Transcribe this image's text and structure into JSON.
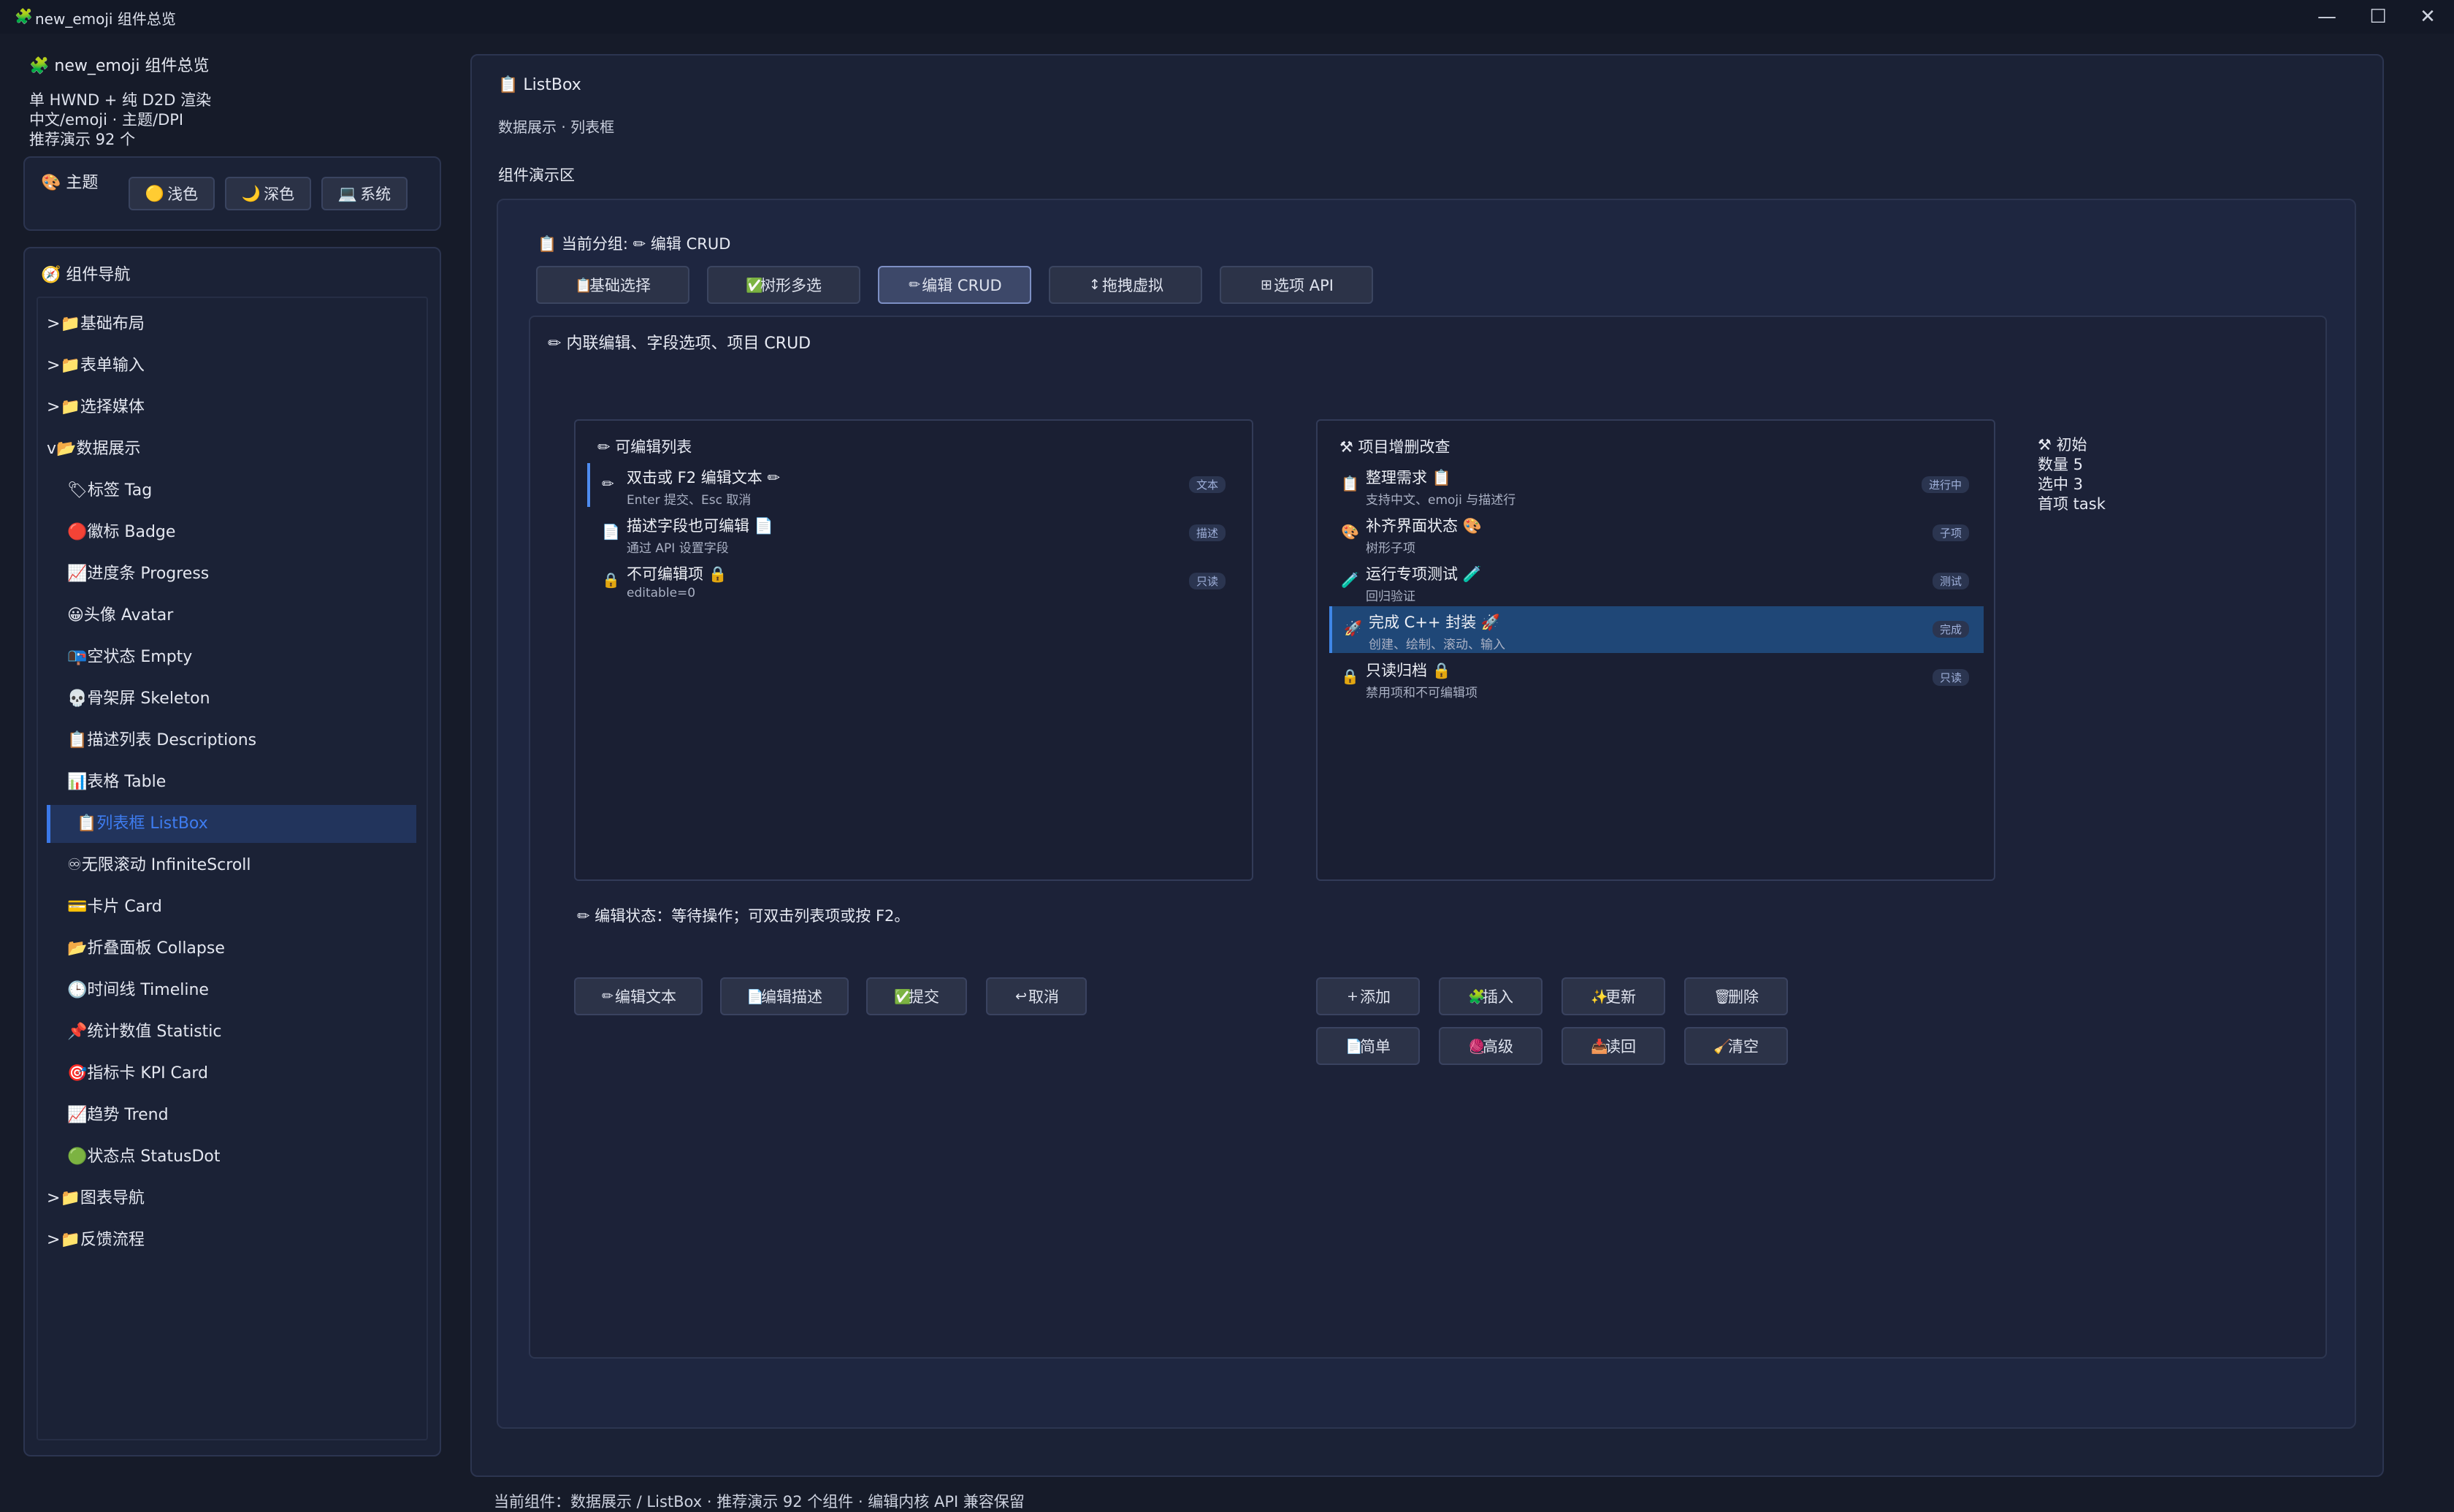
{
  "window": {
    "title": "new_emoji 组件总览",
    "icon": "puzzle-icon",
    "controls": [
      "minimize",
      "maximize",
      "close"
    ]
  },
  "sidebar": {
    "heading": "new_emoji 组件总览",
    "info": [
      "单 HWND + 纯 D2D 渲染",
      "中文/emoji · 主题/DPI",
      "推荐演示 92 个"
    ],
    "theme": {
      "label": "主题",
      "buttons": [
        {
          "icon": "🟡",
          "label": "浅色"
        },
        {
          "icon": "🌙",
          "label": "深色"
        },
        {
          "icon": "💻",
          "label": "系统"
        }
      ]
    },
    "nav": {
      "title": "组件导航",
      "items": [
        {
          "prefix": ">",
          "icon": "📁",
          "label": "基础布局"
        },
        {
          "prefix": ">",
          "icon": "📁",
          "label": "表单输入"
        },
        {
          "prefix": ">",
          "icon": "📁",
          "label": "选择媒体"
        },
        {
          "prefix": "v",
          "icon": "📂",
          "label": "数据展示"
        },
        {
          "prefix": "",
          "icon": "🏷",
          "label": "标签 Tag"
        },
        {
          "prefix": "",
          "icon": "🔴",
          "label": "徽标 Badge"
        },
        {
          "prefix": "",
          "icon": "📈",
          "label": "进度条 Progress"
        },
        {
          "prefix": "",
          "icon": "😀",
          "label": "头像 Avatar"
        },
        {
          "prefix": "",
          "icon": "📭",
          "label": "空状态 Empty"
        },
        {
          "prefix": "",
          "icon": "💀",
          "label": "骨架屏 Skeleton"
        },
        {
          "prefix": "",
          "icon": "📋",
          "label": "描述列表 Descriptions"
        },
        {
          "prefix": "",
          "icon": "📊",
          "label": "表格 Table"
        },
        {
          "prefix": "",
          "icon": "📋",
          "label": "列表框 ListBox"
        },
        {
          "prefix": "",
          "icon": "♾",
          "label": "无限滚动 InfiniteScroll"
        },
        {
          "prefix": "",
          "icon": "💳",
          "label": "卡片 Card"
        },
        {
          "prefix": "",
          "icon": "📂",
          "label": "折叠面板 Collapse"
        },
        {
          "prefix": "",
          "icon": "🕒",
          "label": "时间线 Timeline"
        },
        {
          "prefix": "",
          "icon": "📌",
          "label": "统计数值 Statistic"
        },
        {
          "prefix": "",
          "icon": "🎯",
          "label": "指标卡 KPI Card"
        },
        {
          "prefix": "",
          "icon": "📈",
          "label": "趋势 Trend"
        },
        {
          "prefix": "",
          "icon": "🟢",
          "label": "状态点 StatusDot"
        },
        {
          "prefix": ">",
          "icon": "📁",
          "label": "图表导航"
        },
        {
          "prefix": ">",
          "icon": "📁",
          "label": "反馈流程"
        }
      ],
      "active_index": 12
    }
  },
  "main": {
    "title": "ListBox",
    "subtitle": "数据展示 · 列表框",
    "demo_label": "组件演示区",
    "group_label": "当前分组:",
    "group_value": "编辑 CRUD",
    "tabs": [
      {
        "icon": "📋",
        "label": "基础选择"
      },
      {
        "icon": "✅",
        "label": "树形多选"
      },
      {
        "icon": "✏",
        "label": "编辑 CRUD"
      },
      {
        "icon": "↕",
        "label": "拖拽虚拟"
      },
      {
        "icon": "⊞",
        "label": "选项 API"
      }
    ],
    "active_tab": 2,
    "section_title": "内联编辑、字段选项、项目 CRUD",
    "editable_list": {
      "title": "可编辑列表",
      "items": [
        {
          "icon": "✏",
          "title": "双击或 F2 编辑文本 ✏",
          "desc": "Enter 提交、Esc 取消",
          "badge": "文本"
        },
        {
          "icon": "📄",
          "title": "描述字段也可编辑 📄",
          "desc": "通过 API 设置字段",
          "badge": "描述"
        },
        {
          "icon": "🔒",
          "title": "不可编辑项 🔒",
          "desc": "editable=0",
          "badge": "只读"
        }
      ]
    },
    "crud_list": {
      "title": "项目增删改查",
      "items": [
        {
          "icon": "📋",
          "title": "整理需求 📋",
          "desc": "支持中文、emoji 与描述行",
          "badge": "进行中"
        },
        {
          "icon": "🎨",
          "title": "补齐界面状态 🎨",
          "desc": "树形子项",
          "badge": "子项"
        },
        {
          "icon": "🧪",
          "title": "运行专项测试 🧪",
          "desc": "回归验证",
          "badge": "测试"
        },
        {
          "icon": "🚀",
          "title": "完成 C++ 封装 🚀",
          "desc": "创建、绘制、滚动、输入",
          "badge": "完成"
        },
        {
          "icon": "🔒",
          "title": "只读归档 🔒",
          "desc": "禁用项和不可编辑项",
          "badge": "只读"
        }
      ],
      "selected_index": 3
    },
    "status_box": {
      "title": "初始",
      "lines": [
        "数量 5",
        "选中 3",
        "首项 task"
      ]
    },
    "edit_status": "编辑状态：等待操作；可双击列表项或按 F2。",
    "edit_buttons": [
      {
        "icon": "✏",
        "label": "编辑文本"
      },
      {
        "icon": "📄",
        "label": "编辑描述"
      },
      {
        "icon": "✅",
        "label": "提交"
      },
      {
        "icon": "↩",
        "label": "取消"
      }
    ],
    "crud_buttons_row1": [
      {
        "icon": "+",
        "label": "添加"
      },
      {
        "icon": "🧩",
        "label": "插入"
      },
      {
        "icon": "✨",
        "label": "更新"
      },
      {
        "icon": "🗑",
        "label": "删除"
      }
    ],
    "crud_buttons_row2": [
      {
        "icon": "📄",
        "label": "简单"
      },
      {
        "icon": "🧶",
        "label": "高级"
      },
      {
        "icon": "📥",
        "label": "读回"
      },
      {
        "icon": "🧹",
        "label": "清空"
      }
    ]
  },
  "footer": "当前组件：数据展示 / ListBox · 推荐演示 92 个组件 · 编辑内核 API 兼容保留",
  "colors": {
    "background": "#161b29",
    "accent": "#3b78e8",
    "selected_row": "#1f4777"
  }
}
